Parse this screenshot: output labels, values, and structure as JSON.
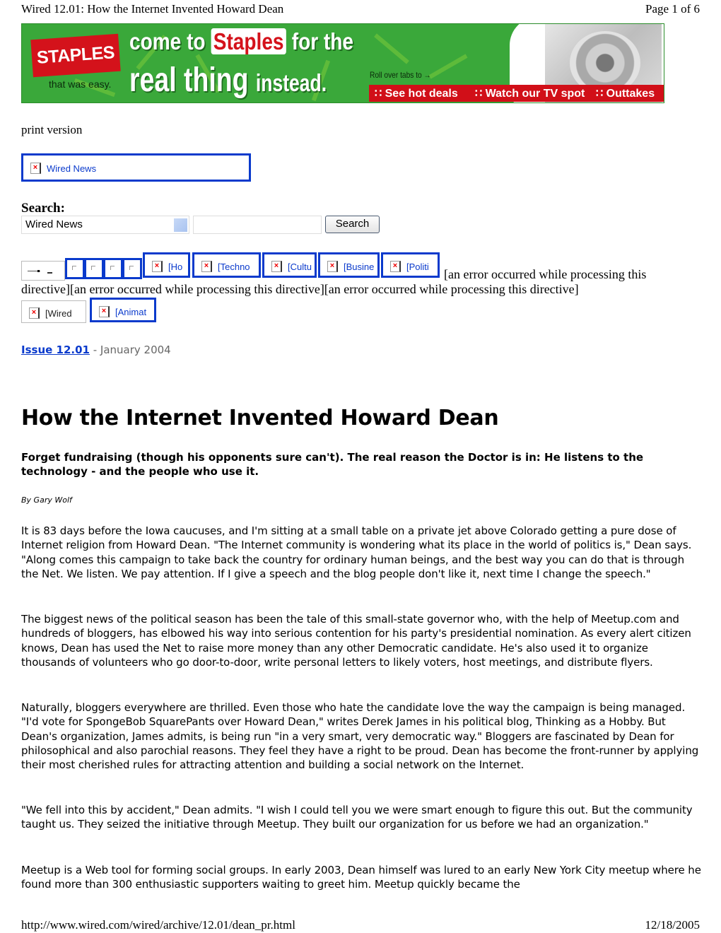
{
  "print_header": {
    "title": "Wired 12.01: How the Internet Invented Howard Dean",
    "page": "Page 1 of 6"
  },
  "ad": {
    "brand_logo": "STAPLES",
    "tagline": "that was easy.",
    "line1_pre": "come to",
    "line1_brand": "Staples",
    "line1_post": "for the",
    "line2_big": "real thing",
    "line2_small": "instead.",
    "roll_over": "Roll over tabs to →",
    "tabs": [
      "∷ See hot deals",
      "∷ Watch our TV spot",
      "∷ Outtakes"
    ],
    "colors": {
      "green": "#3aa83a",
      "red": "#d10f18"
    }
  },
  "print_version": "print version",
  "wired_news_box": {
    "link": "Wired News",
    "icon": "broken-image-icon"
  },
  "search": {
    "label": "Search:",
    "scope_value": "Wired News",
    "query_value": "",
    "button": "Search"
  },
  "nav": {
    "items": [
      "[Ho",
      "[Techno",
      "[Cultu",
      "[Busine",
      "[Politi"
    ],
    "row2": [
      "[Wired",
      "[Animat"
    ],
    "error_line1": "[an error occurred while processing this",
    "error_line2": "directive][an error occurred while processing this directive][an error occurred while processing this directive]"
  },
  "issue": {
    "link": "Issue 12.01",
    "date": " - January 2004"
  },
  "article": {
    "title": "How the Internet Invented Howard Dean",
    "dek": "Forget fundraising (though his opponents sure can't). The real reason the Doctor is in: He listens to the technology - and the people who use it.",
    "byline": "By Gary Wolf",
    "paragraphs": [
      "It is 83 days before the Iowa caucuses, and I'm sitting at a small table on a private jet above Colorado getting a pure dose of Internet religion from Howard Dean. \"The Internet community is wondering what its place in the world of politics is,\" Dean says. \"Along comes this campaign to take back the country for ordinary human beings, and the best way you can do that is through the Net. We listen. We pay attention. If I give a speech and the blog people don't like it, next time I change the speech.\"",
      "The biggest news of the political season has been the tale of this small-state governor who, with the help of Meetup.com and hundreds of bloggers, has elbowed his way into serious contention for his party's presidential nomination. As every alert citizen knows, Dean has used the Net to raise more money than any other Democratic candidate. He's also used it to organize thousands of volunteers who go door-to-door, write personal letters to likely voters, host meetings, and distribute flyers.",
      "Naturally, bloggers everywhere are thrilled. Even those who hate the candidate love the way the campaign is being managed. \"I'd vote for SpongeBob SquarePants over Howard Dean,\" writes Derek James in his political blog, Thinking as a Hobby. But Dean's organization, James admits, is being run \"in a very smart, very democratic way.\" Bloggers are fascinated by Dean for philosophical and also parochial reasons. They feel they have a right to be proud. Dean has become the front-runner by applying their most cherished rules for attracting attention and building a social network on the Internet.",
      "\"We fell into this by accident,\" Dean admits. \"I wish I could tell you we were smart enough to figure this out. But the community taught us. They seized the initiative through Meetup. They built our organization for us before we had an organization.\"",
      "Meetup is a Web tool for forming social groups. In early 2003, Dean himself was lured to an early New York City meetup where he found more than 300 enthusiastic supporters waiting to greet him. Meetup quickly became the"
    ]
  },
  "print_footer": {
    "url": "http://www.wired.com/wired/archive/12.01/dean_pr.html",
    "date": "12/18/2005"
  }
}
